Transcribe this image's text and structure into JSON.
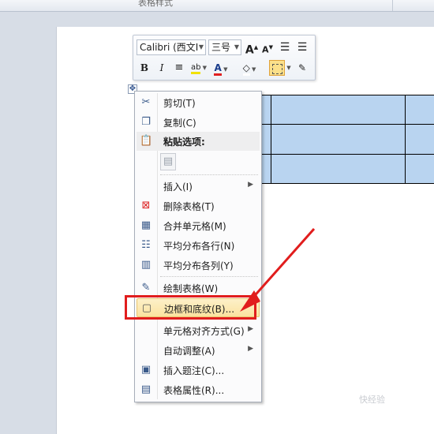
{
  "ribbon": {
    "group_label": "表格样式"
  },
  "mini_toolbar": {
    "font_name": "Calibri (西文I",
    "font_size": "三号",
    "grow_font": "A",
    "shrink_font": "A",
    "bold": "B",
    "italic": "I",
    "font_color_letter": "A",
    "highlight_label": "ab"
  },
  "context_menu": {
    "items": [
      {
        "label": "剪切(T)",
        "icon": "scissors-icon"
      },
      {
        "label": "复制(C)",
        "icon": "copy-icon"
      },
      {
        "label": "粘贴选项:",
        "icon": "paste-icon"
      },
      {
        "label": "插入(I)",
        "icon": "none",
        "submenu": true
      },
      {
        "label": "删除表格(T)",
        "icon": "delete-table-icon"
      },
      {
        "label": "合并单元格(M)",
        "icon": "merge-cells-icon"
      },
      {
        "label": "平均分布各行(N)",
        "icon": "distribute-rows-icon"
      },
      {
        "label": "平均分布各列(Y)",
        "icon": "distribute-columns-icon"
      },
      {
        "label": "绘制表格(W)",
        "icon": "draw-table-icon"
      },
      {
        "label": "边框和底纹(B)...",
        "icon": "borders-shading-icon",
        "highlighted": true
      },
      {
        "label": "单元格对齐方式(G)",
        "icon": "none",
        "submenu": true
      },
      {
        "label": "自动调整(A)",
        "icon": "none",
        "submenu": true
      },
      {
        "label": "插入题注(C)...",
        "icon": "insert-caption-icon"
      },
      {
        "label": "表格属性(R)...",
        "icon": "table-properties-icon"
      }
    ]
  },
  "annotation_color": "#e11d1d",
  "table_fill_color": "#b9d4f0",
  "watermark": "快经验"
}
